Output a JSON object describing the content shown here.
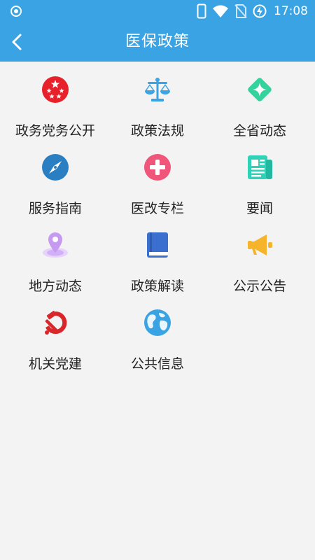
{
  "status_bar": {
    "time": "17:08"
  },
  "header": {
    "title": "医保政策"
  },
  "menu": [
    {
      "label": "政务党务公开",
      "icon": "star-badge-icon",
      "color": "#e8202a"
    },
    {
      "label": "政策法规",
      "icon": "scales-icon",
      "color": "#3aa3e3"
    },
    {
      "label": "全省动态",
      "icon": "diamond-sparkle-icon",
      "color": "#34d39e"
    },
    {
      "label": "服务指南",
      "icon": "compass-icon",
      "color": "#2a7fc2"
    },
    {
      "label": "医改专栏",
      "icon": "medical-cross-icon",
      "color": "#f0557a"
    },
    {
      "label": "要闻",
      "icon": "newspaper-icon",
      "color": "#2fd2b7"
    },
    {
      "label": "地方动态",
      "icon": "location-pin-icon",
      "color": "#c79af2"
    },
    {
      "label": "政策解读",
      "icon": "book-icon",
      "color": "#3a6fcf"
    },
    {
      "label": "公示公告",
      "icon": "megaphone-icon",
      "color": "#f5b42a"
    },
    {
      "label": "机关党建",
      "icon": "hammer-sickle-icon",
      "color": "#d9262a"
    },
    {
      "label": "公共信息",
      "icon": "globe-icon",
      "color": "#3aa3e3"
    }
  ]
}
